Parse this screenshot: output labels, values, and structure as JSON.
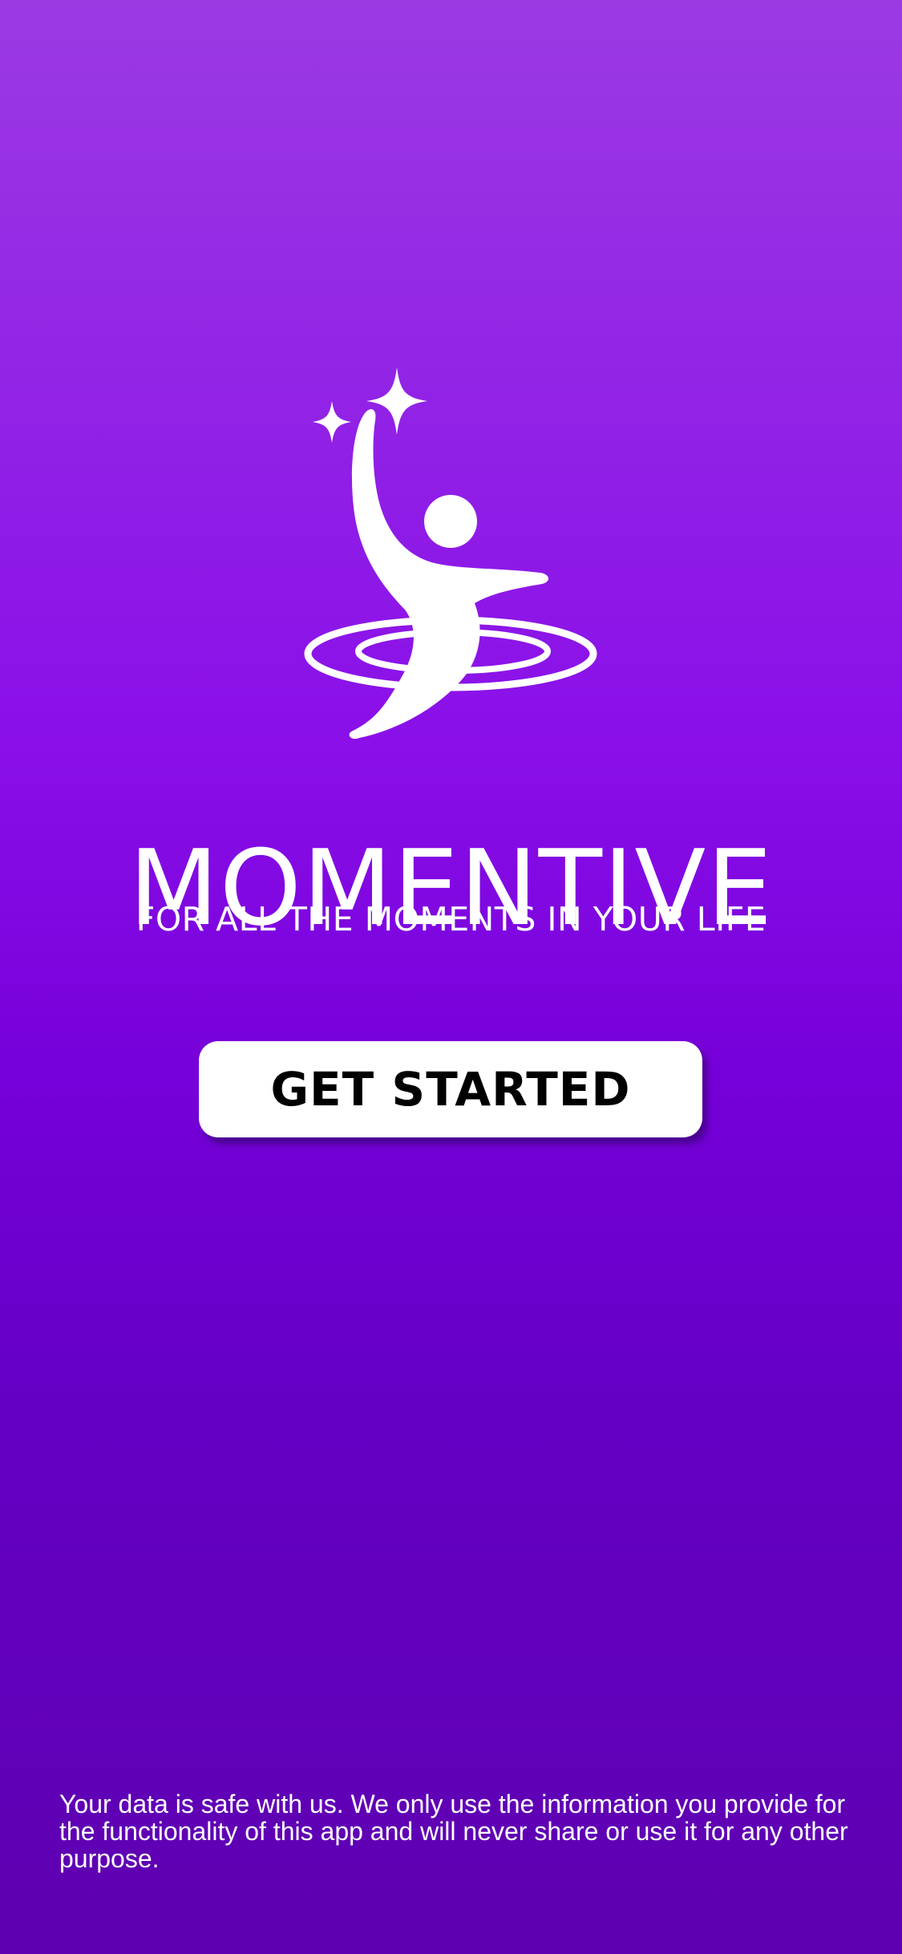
{
  "app": {
    "name": "MOMENTIVE",
    "tagline": "FOR ALL THE MOMENTS IN YOUR LIFE"
  },
  "logo": {
    "icon": "reaching-figure-with-stars-icon",
    "color": "#FFFFFF"
  },
  "cta": {
    "label": "GET STARTED"
  },
  "footer": {
    "privacy_text": "Your data is safe with us. We only use the information you provide for the functionality of this app and will never share or use it for any other purpose."
  },
  "theme": {
    "gradient_top": "#9B3AE3",
    "gradient_bottom": "#5E00B0",
    "button_background": "#FFFFFF",
    "button_text": "#000000"
  }
}
